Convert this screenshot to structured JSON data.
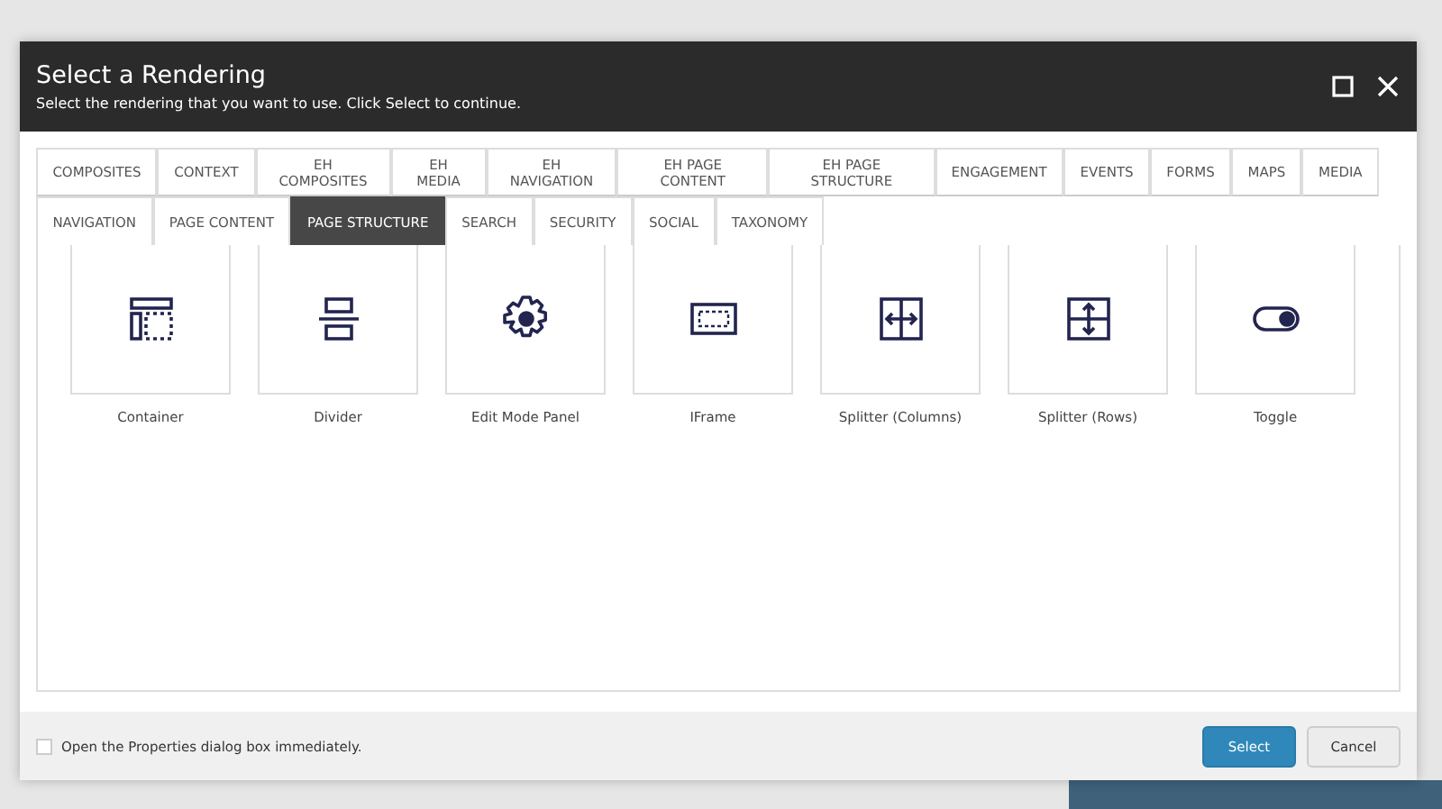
{
  "dialog": {
    "title": "Select a Rendering",
    "subtitle": "Select the rendering that you want to use. Click Select to continue."
  },
  "tab_rows": [
    [
      {
        "label": "COMPOSITES",
        "selected": false
      },
      {
        "label": "CONTEXT",
        "selected": false
      },
      {
        "label": "EH COMPOSITES",
        "selected": false
      },
      {
        "label": "EH MEDIA",
        "selected": false
      },
      {
        "label": "EH NAVIGATION",
        "selected": false
      },
      {
        "label": "EH PAGE CONTENT",
        "selected": false
      },
      {
        "label": "EH PAGE STRUCTURE",
        "selected": false
      },
      {
        "label": "ENGAGEMENT",
        "selected": false
      },
      {
        "label": "EVENTS",
        "selected": false
      },
      {
        "label": "FORMS",
        "selected": false
      },
      {
        "label": "MAPS",
        "selected": false
      },
      {
        "label": "MEDIA",
        "selected": false
      }
    ],
    [
      {
        "label": "NAVIGATION",
        "selected": false
      },
      {
        "label": "PAGE CONTENT",
        "selected": false
      },
      {
        "label": "PAGE STRUCTURE",
        "selected": true
      },
      {
        "label": "SEARCH",
        "selected": false
      },
      {
        "label": "SECURITY",
        "selected": false
      },
      {
        "label": "SOCIAL",
        "selected": false
      },
      {
        "label": "TAXONOMY",
        "selected": false
      }
    ]
  ],
  "renderings": [
    {
      "label": "Container",
      "kind": "container"
    },
    {
      "label": "Divider",
      "kind": "divider"
    },
    {
      "label": "Edit Mode Panel",
      "kind": "gear"
    },
    {
      "label": "IFrame",
      "kind": "frame"
    },
    {
      "label": "Splitter (Columns)",
      "kind": "columns"
    },
    {
      "label": "Splitter (Rows)",
      "kind": "rows"
    },
    {
      "label": "Toggle",
      "kind": "toggle"
    }
  ],
  "footer": {
    "checkbox": {
      "label": "Open the Properties dialog box immediately.",
      "checked": false
    },
    "buttons": [
      {
        "label": "Select",
        "kind": "primary"
      },
      {
        "label": "Cancel",
        "kind": "secondary"
      }
    ]
  }
}
